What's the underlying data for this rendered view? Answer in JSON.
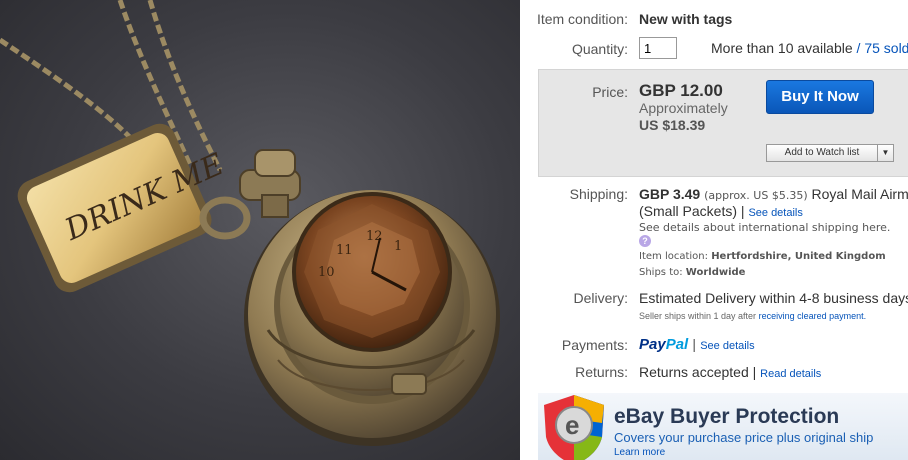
{
  "photo": {
    "tag_text": "DRINK ME",
    "clock_numerals": [
      "12",
      "1",
      "11",
      "10"
    ]
  },
  "condition": {
    "label": "Item condition:",
    "value": "New with tags"
  },
  "quantity": {
    "label": "Quantity:",
    "value": "1",
    "available": "More than 10 available",
    "separator": "/",
    "sold": "75 sold"
  },
  "price": {
    "label": "Price:",
    "value": "GBP 12.00",
    "approx_label": "Approximately",
    "approx_value": "US $18.39",
    "buy_now": "Buy It Now",
    "watch": "Add to Watch list",
    "watch_dropdown": "▼"
  },
  "shipping": {
    "label": "Shipping:",
    "cost": "GBP 3.49",
    "approx": "(approx. US $5.35)",
    "service": "Royal Mail Airm",
    "service_detail": "(Small Packets) |",
    "see_details": "See details",
    "international": "See details about international shipping here.",
    "help_icon": "?",
    "location_label": "Item location:",
    "location": "Hertfordshire, United Kingdom",
    "ships_to_label": "Ships to:",
    "ships_to": "Worldwide"
  },
  "delivery": {
    "label": "Delivery:",
    "value": "Estimated Delivery within 4-8 business days",
    "note": "Seller ships within 1 day after",
    "note_link": "receiving cleared payment."
  },
  "payments": {
    "label": "Payments:",
    "paypal_1": "Pay",
    "paypal_2": "Pal",
    "separator": "|",
    "see_details": "See details"
  },
  "returns": {
    "label": "Returns:",
    "value": "Returns accepted",
    "separator": "|",
    "read_details": "Read details"
  },
  "protection": {
    "title": "eBay Buyer Protection",
    "subtitle": "Covers your purchase price plus original ship",
    "learn_more": "Learn more",
    "shield_letter": "e"
  }
}
